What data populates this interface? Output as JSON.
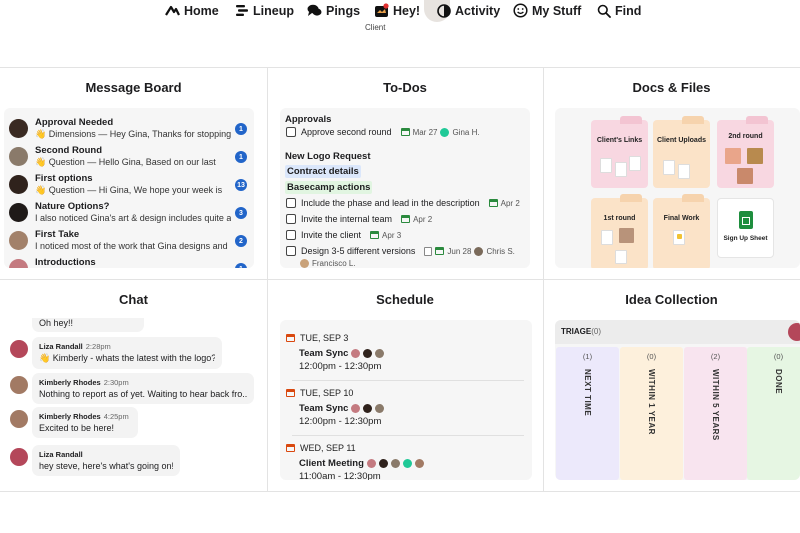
{
  "nav": {
    "items": [
      {
        "label": "Home",
        "icon": "basecamp-mountain-icon"
      },
      {
        "label": "Lineup",
        "icon": "lineup-icon"
      },
      {
        "label": "Pings",
        "icon": "chat-bubbles-icon"
      },
      {
        "label": "Hey!",
        "icon": "hey-inbox-icon"
      },
      {
        "label": "Activity",
        "icon": "activity-icon"
      },
      {
        "label": "My Stuff",
        "icon": "smiley-icon"
      },
      {
        "label": "Find",
        "icon": "search-icon"
      }
    ],
    "project_label": "Client"
  },
  "message_board": {
    "title": "Message Board",
    "items": [
      {
        "title": "Approval Needed",
        "excerpt": "👋 Dimensions — Hey Gina, Thanks for stopping",
        "count": "1"
      },
      {
        "title": "Second Round",
        "excerpt": "👋 Question — Hello Gina, Based on our last",
        "count": "1"
      },
      {
        "title": "First options",
        "excerpt": "👋 Question — Hi Gina, We hope your week is",
        "count": "13"
      },
      {
        "title": "Nature Options?",
        "excerpt": "I also noticed Gina's art & design includes quite a",
        "count": "3"
      },
      {
        "title": "First Take",
        "excerpt": "I noticed most of the work that Gina designs and",
        "count": "2"
      },
      {
        "title": "Introductions",
        "excerpt": "",
        "count": "1"
      }
    ]
  },
  "todos": {
    "title": "To-Dos",
    "group1": {
      "heading": "Approvals",
      "items": [
        {
          "text": "Approve second round",
          "date": "Mar 27",
          "assignee": "Gina H."
        }
      ]
    },
    "group2": {
      "heading": "New Logo Request",
      "label_blue": "Contract details",
      "label_green": "Basecamp actions",
      "items": [
        {
          "text": "Include the phase and lead in the description",
          "date": "Apr 2"
        },
        {
          "text": "Invite the internal team",
          "date": "Apr 2"
        },
        {
          "text": "Invite the client",
          "date": "Apr 3"
        },
        {
          "text": "Design 3-5 different versions",
          "date": "Jun 28",
          "assignee": "Chris S.",
          "assignee2": "Francisco L."
        }
      ]
    }
  },
  "docs": {
    "title": "Docs & Files",
    "folders": [
      {
        "name": "Client's Links"
      },
      {
        "name": "Client Uploads"
      },
      {
        "name": "2nd round"
      },
      {
        "name": "1st round"
      },
      {
        "name": "Final Work"
      }
    ],
    "sheet": {
      "name": "Sign Up Sheet"
    }
  },
  "chat": {
    "title": "Chat",
    "top_fragment": "Oh hey!!",
    "messages": [
      {
        "author": "Liza Randall",
        "time": "2:28pm",
        "text": "👋 Kimberly - whats the latest with the logo?"
      },
      {
        "author": "Kimberly Rhodes",
        "time": "2:30pm",
        "text": "Nothing to report as of yet. Waiting to hear back fro..."
      },
      {
        "author": "Kimberly Rhodes",
        "time": "4:25pm",
        "text": "Excited to be here!"
      },
      {
        "author": "Liza Randall",
        "time": "",
        "text": "hey steve, here's what's going on!"
      }
    ]
  },
  "schedule": {
    "title": "Schedule",
    "events": [
      {
        "date": "TUE, SEP 3",
        "title": "Team Sync",
        "time": "12:00pm - 12:30pm"
      },
      {
        "date": "TUE, SEP 10",
        "title": "Team Sync",
        "time": "12:00pm - 12:30pm"
      },
      {
        "date": "WED, SEP 11",
        "title": "Client Meeting",
        "time": "11:00am - 12:30pm"
      }
    ]
  },
  "ideas": {
    "title": "Idea Collection",
    "triage_label": "TRIAGE",
    "triage_count": "(0)",
    "columns": [
      {
        "count": "(1)",
        "name": "NEXT TIME",
        "color": "#ece9fb"
      },
      {
        "count": "(0)",
        "name": "WITHIN 1 YEAR",
        "color": "#fdf0dc"
      },
      {
        "count": "(2)",
        "name": "WITHIN 5 YEARS",
        "color": "#f8e4ef"
      },
      {
        "count": "(0)",
        "name": "DONE",
        "color": "#e6f6e3"
      }
    ]
  },
  "colors": {
    "badge": "#2265c9",
    "folder_pink": "#f8d7e1",
    "folder_peach": "#fbe3c8",
    "sheet_green": "#1e8e3e"
  }
}
